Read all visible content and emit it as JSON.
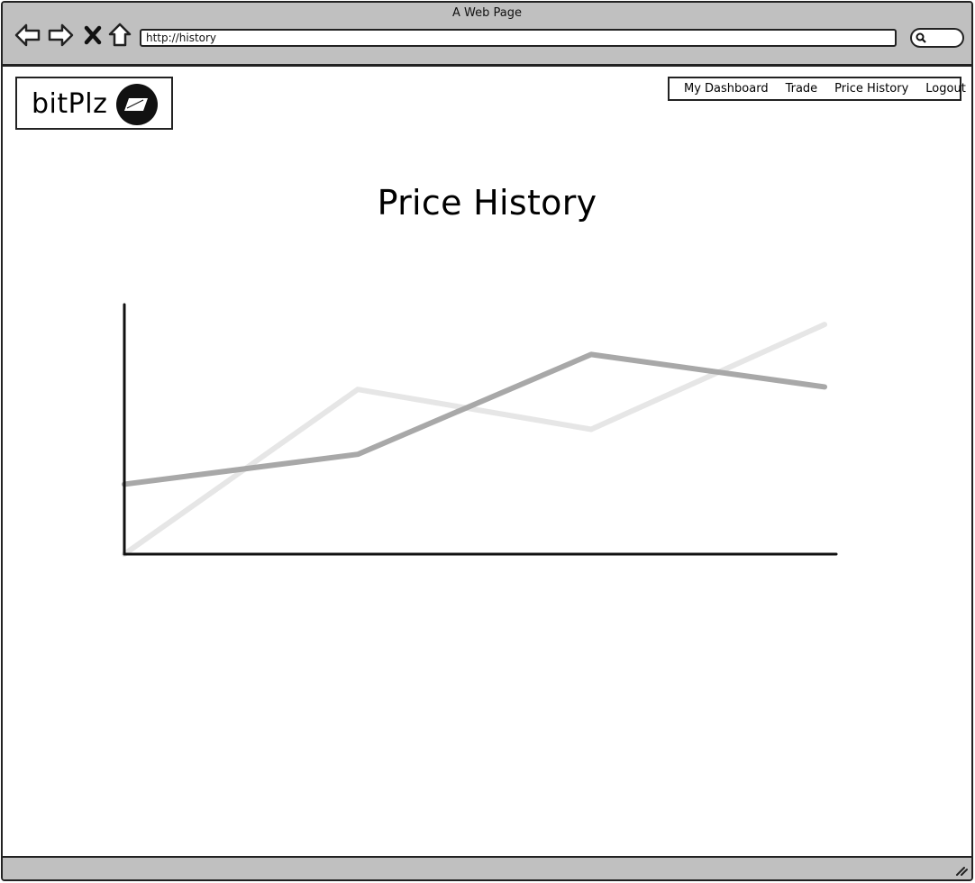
{
  "window": {
    "title": "A Web Page",
    "url": "http://history"
  },
  "brand": {
    "name": "bitPlz"
  },
  "nav": {
    "items": [
      "My Dashboard",
      "Trade",
      "Price History",
      "Logout"
    ]
  },
  "page": {
    "title": "Price History"
  },
  "chart_data": {
    "type": "line",
    "title": "",
    "xlabel": "",
    "ylabel": "",
    "x": [
      0,
      1,
      2,
      3
    ],
    "xlim": [
      0,
      3.05
    ],
    "ylim": [
      0,
      100
    ],
    "grid": false,
    "series": [
      {
        "values": [
          28,
          40,
          80,
          67
        ],
        "color": "#a8a8a8"
      },
      {
        "values": [
          0,
          66,
          50,
          92
        ],
        "color": "#e6e6e6"
      }
    ]
  },
  "icons": {
    "back": "back-arrow-icon",
    "forward": "forward-arrow-icon",
    "stop": "close-icon",
    "home": "home-icon",
    "search": "search-icon",
    "logo": "logo-icon",
    "resize": "resize-grip-icon"
  }
}
